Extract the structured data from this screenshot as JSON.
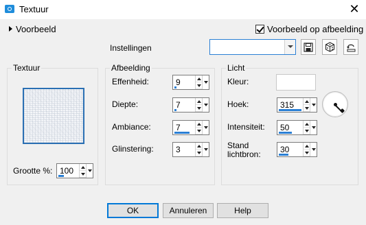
{
  "window": {
    "title": "Textuur",
    "close_label": "✕"
  },
  "preview": {
    "toggle_label": "Voorbeeld",
    "on_image_label": "Voorbeeld op afbeelding",
    "on_image_checked": true
  },
  "presets": {
    "label": "Instellingen",
    "value": ""
  },
  "toolbar": {
    "icons": [
      "save-preset-icon",
      "random-icon",
      "reset-icon"
    ]
  },
  "texture": {
    "group_label": "Textuur",
    "size_label": "Grootte %:",
    "size_value": "100",
    "size_fill": 0.25
  },
  "image": {
    "group_label": "Afbeelding",
    "fields": [
      {
        "label": "Effenheid:",
        "value": "9",
        "fill": 0.09
      },
      {
        "label": "Diepte:",
        "value": "7",
        "fill": 0.07
      },
      {
        "label": "Ambiance:",
        "value": "7",
        "fill": 0.36
      },
      {
        "label": "Glinstering:",
        "value": "3",
        "fill": 0.0
      }
    ]
  },
  "light": {
    "group_label": "Licht",
    "color_label": "Kleur:",
    "color_value": "#ffffff",
    "angle_label": "Hoek:",
    "angle_value": "315",
    "angle_fill": 0.88,
    "intensity_label": "Intensiteit:",
    "intensity_value": "50",
    "intensity_fill": 0.5,
    "position_label_1": "Stand",
    "position_label_2": "lichtbron:",
    "position_value": "30",
    "position_fill": 0.3
  },
  "buttons": {
    "ok": "OK",
    "cancel": "Annuleren",
    "help": "Help"
  }
}
